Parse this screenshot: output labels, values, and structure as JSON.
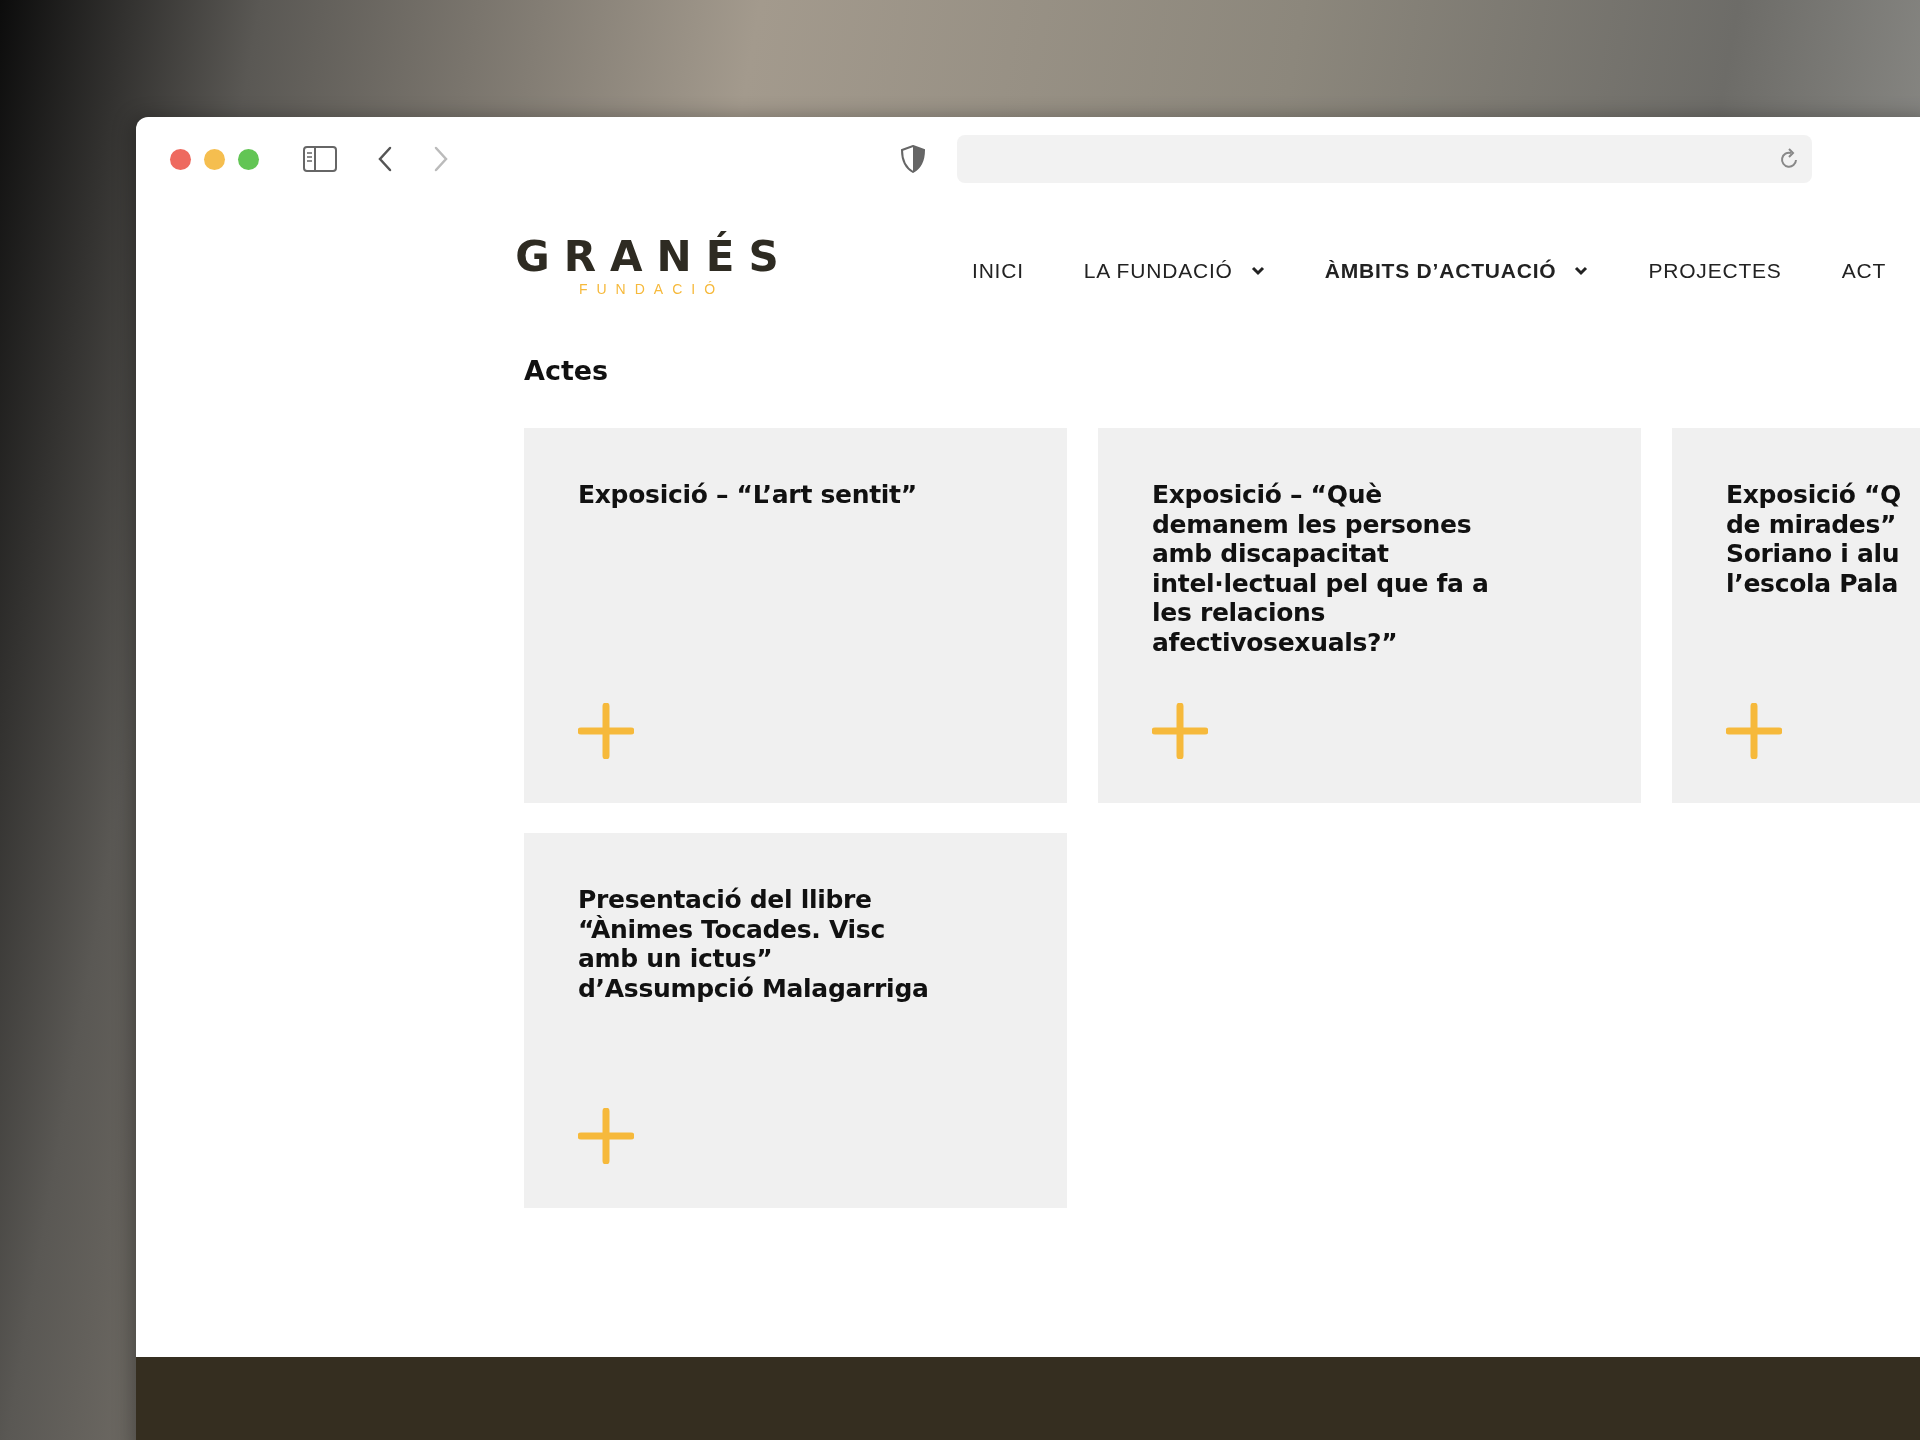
{
  "logo": {
    "name": "GRANÉS",
    "subtitle": "FUNDACIÓ"
  },
  "nav": [
    {
      "label": "INICI",
      "dropdown": false,
      "selected": false
    },
    {
      "label": "LA FUNDACIÓ",
      "dropdown": true,
      "selected": false
    },
    {
      "label": "ÀMBITS D’ACTUACIÓ",
      "dropdown": true,
      "selected": true
    },
    {
      "label": "PROJECTES",
      "dropdown": false,
      "selected": false
    },
    {
      "label": "ACT",
      "dropdown": false,
      "selected": false
    }
  ],
  "heading": "Actes",
  "cards": [
    {
      "title_lines": [
        "Exposició – “L’art sentit”"
      ]
    },
    {
      "title_lines": [
        "Exposició – “Què",
        "demanem les persones",
        "amb discapacitat",
        "intel·lectual pel que fa a",
        "les relacions",
        "afectivosexuals?”"
      ]
    },
    {
      "title_lines": [
        "Exposició “Q",
        "de mirades”",
        "Soriano i alu",
        "l’escola Pala"
      ]
    },
    {
      "title_lines": [
        "Presentació del llibre",
        "“Ànimes Tocades. Visc",
        "amb un ictus”",
        "d’Assumpció Malagarriga"
      ]
    }
  ]
}
